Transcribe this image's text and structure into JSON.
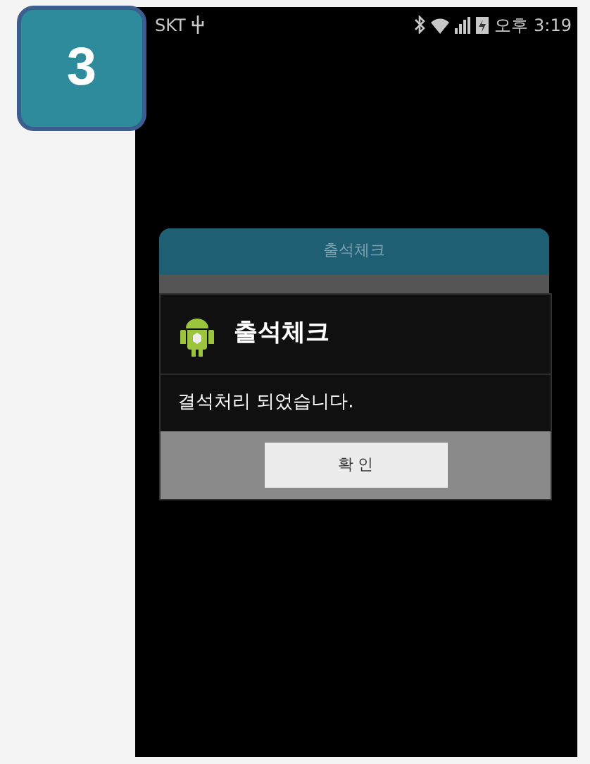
{
  "step_badge": "3",
  "status_bar": {
    "carrier": "SKT",
    "time": "오후 3:19"
  },
  "background_dialog": {
    "title": "출석체크"
  },
  "dialog": {
    "title": "출석체크",
    "message": "결석처리 되었습니다.",
    "buttons": [
      "확 인"
    ]
  }
}
